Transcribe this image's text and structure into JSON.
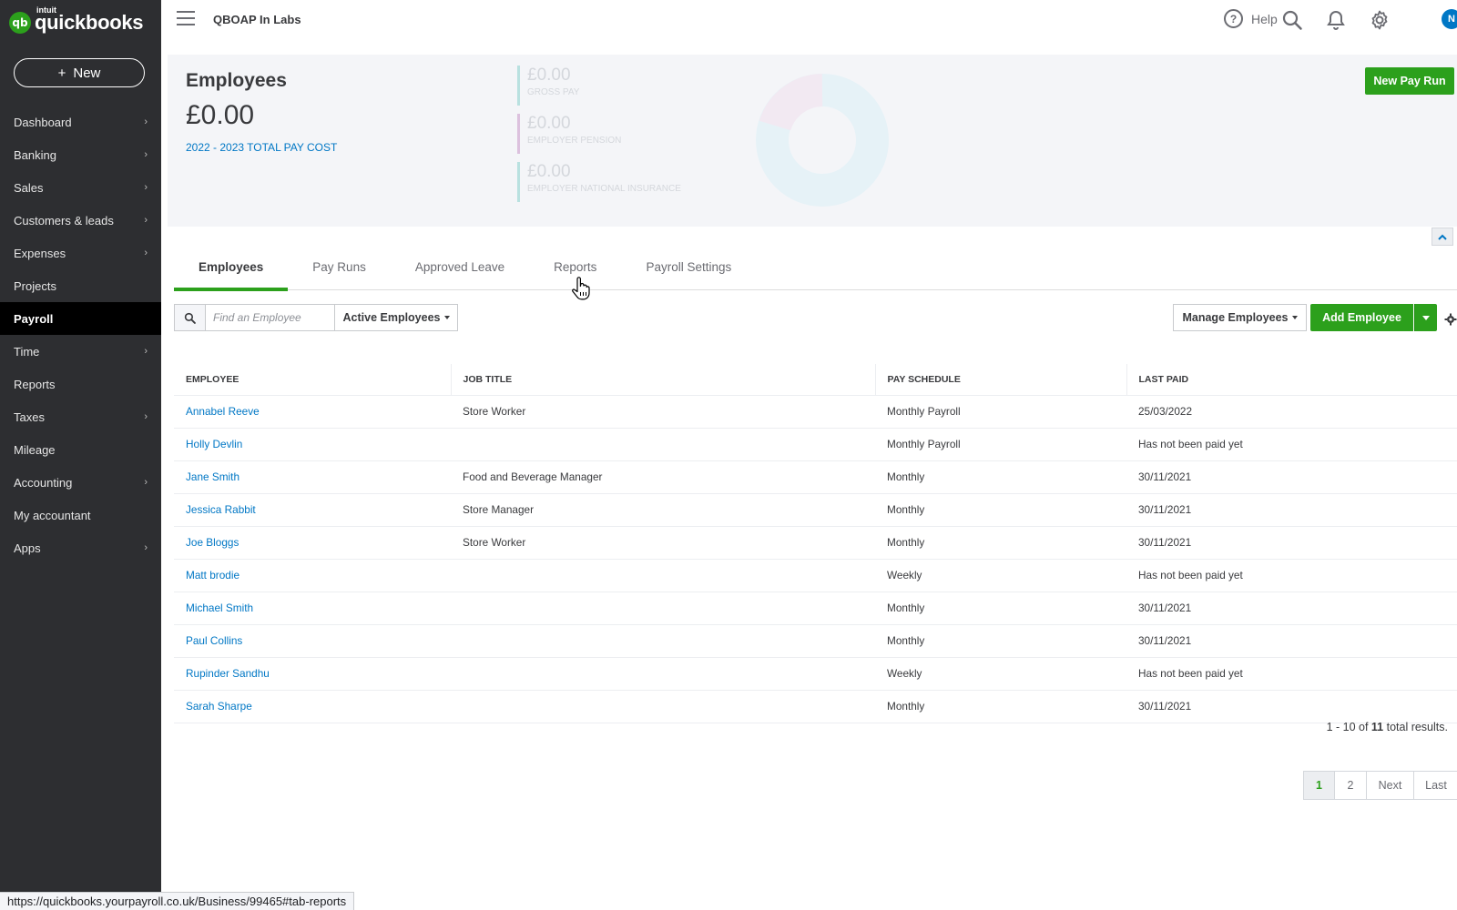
{
  "app": {
    "logo_brand": "intuit",
    "logo_name": "quickbooks",
    "logo_badge": "qb",
    "company_name": "QBOAP In Labs"
  },
  "sidebar": {
    "new_label": "New",
    "items": [
      {
        "label": "Dashboard",
        "has_chevron": true
      },
      {
        "label": "Banking",
        "has_chevron": true
      },
      {
        "label": "Sales",
        "has_chevron": true
      },
      {
        "label": "Customers & leads",
        "has_chevron": true
      },
      {
        "label": "Expenses",
        "has_chevron": true
      },
      {
        "label": "Projects",
        "has_chevron": false
      },
      {
        "label": "Payroll",
        "has_chevron": false,
        "active": true
      },
      {
        "label": "Time",
        "has_chevron": true
      },
      {
        "label": "Reports",
        "has_chevron": false
      },
      {
        "label": "Taxes",
        "has_chevron": true
      },
      {
        "label": "Mileage",
        "has_chevron": false
      },
      {
        "label": "Accounting",
        "has_chevron": true
      },
      {
        "label": "My accountant",
        "has_chevron": false
      },
      {
        "label": "Apps",
        "has_chevron": true
      }
    ]
  },
  "topbar": {
    "help_label": "Help",
    "avatar_initial": "N",
    "icons": [
      "search-icon",
      "bell-icon",
      "gear-icon"
    ]
  },
  "summary": {
    "title": "Employees",
    "total_amount": "£0.00",
    "total_label": "2022 - 2023 TOTAL PAY COST",
    "metrics": [
      {
        "value": "£0.00",
        "label": "GROSS PAY",
        "color": "#b9e1e0"
      },
      {
        "value": "£0.00",
        "label": "EMPLOYER PENSION",
        "color": "#dcc1de"
      },
      {
        "value": "£0.00",
        "label": "EMPLOYER NATIONAL INSURANCE",
        "color": "#b9e1e0"
      }
    ],
    "new_pay_run_label": "New Pay Run"
  },
  "tabs": [
    {
      "label": "Employees",
      "active": true
    },
    {
      "label": "Pay Runs",
      "active": false
    },
    {
      "label": "Approved Leave",
      "active": false
    },
    {
      "label": "Reports",
      "active": false
    },
    {
      "label": "Payroll Settings",
      "active": false
    }
  ],
  "toolbar": {
    "search_placeholder": "Find an Employee",
    "search_value": "",
    "filter_label": "Active Employees",
    "manage_label": "Manage Employees",
    "add_label": "Add Employee"
  },
  "table": {
    "columns": [
      "EMPLOYEE",
      "JOB TITLE",
      "PAY SCHEDULE",
      "LAST PAID"
    ],
    "rows": [
      {
        "employee": "Annabel Reeve",
        "job_title": "Store Worker",
        "pay_schedule": "Monthly Payroll",
        "last_paid": "25/03/2022"
      },
      {
        "employee": "Holly Devlin",
        "job_title": "",
        "pay_schedule": "Monthly Payroll",
        "last_paid": "Has not been paid yet"
      },
      {
        "employee": "Jane Smith",
        "job_title": "Food and Beverage Manager",
        "pay_schedule": "Monthly",
        "last_paid": "30/11/2021"
      },
      {
        "employee": "Jessica Rabbit",
        "job_title": "Store Manager",
        "pay_schedule": "Monthly",
        "last_paid": "30/11/2021"
      },
      {
        "employee": "Joe Bloggs",
        "job_title": "Store Worker",
        "pay_schedule": "Monthly",
        "last_paid": "30/11/2021"
      },
      {
        "employee": "Matt brodie",
        "job_title": "",
        "pay_schedule": "Weekly",
        "last_paid": "Has not been paid yet"
      },
      {
        "employee": "Michael Smith",
        "job_title": "",
        "pay_schedule": "Monthly",
        "last_paid": "30/11/2021"
      },
      {
        "employee": "Paul Collins",
        "job_title": "",
        "pay_schedule": "Monthly",
        "last_paid": "30/11/2021"
      },
      {
        "employee": "Rupinder Sandhu",
        "job_title": "",
        "pay_schedule": "Weekly",
        "last_paid": "Has not been paid yet"
      },
      {
        "employee": "Sarah Sharpe",
        "job_title": "",
        "pay_schedule": "Monthly",
        "last_paid": "30/11/2021"
      }
    ]
  },
  "results": {
    "prefix": "1 - 10 of ",
    "total": "11",
    "suffix": " total results."
  },
  "pagination": {
    "pages": [
      "1",
      "2"
    ],
    "current": "1",
    "next_label": "Next",
    "last_label": "Last"
  },
  "status_url": "https://quickbooks.yourpayroll.co.uk/Business/99465#tab-reports",
  "colors": {
    "brand_green": "#2ca01c",
    "link_blue": "#0077c5",
    "sidebar_bg": "#2d2e31",
    "active_nav_bg": "#000000"
  }
}
